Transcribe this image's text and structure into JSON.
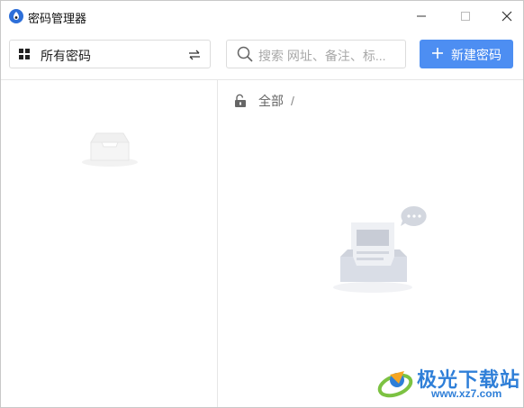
{
  "window": {
    "title": "密码管理器",
    "controls": [
      "minimize",
      "maximize",
      "close"
    ]
  },
  "toolbar": {
    "vault_select_label": "所有密码",
    "search_placeholder": "搜索 网址、备注、标...",
    "new_button_label": "新建密码"
  },
  "breadcrumb": {
    "root": "全部",
    "separator": "/"
  },
  "colors": {
    "accent": "#4d8ef2",
    "border": "#dcdcdc",
    "empty_illustration": "#d9dde6"
  },
  "watermark": {
    "name": "极光下载站",
    "url": "www.xz7.com"
  }
}
